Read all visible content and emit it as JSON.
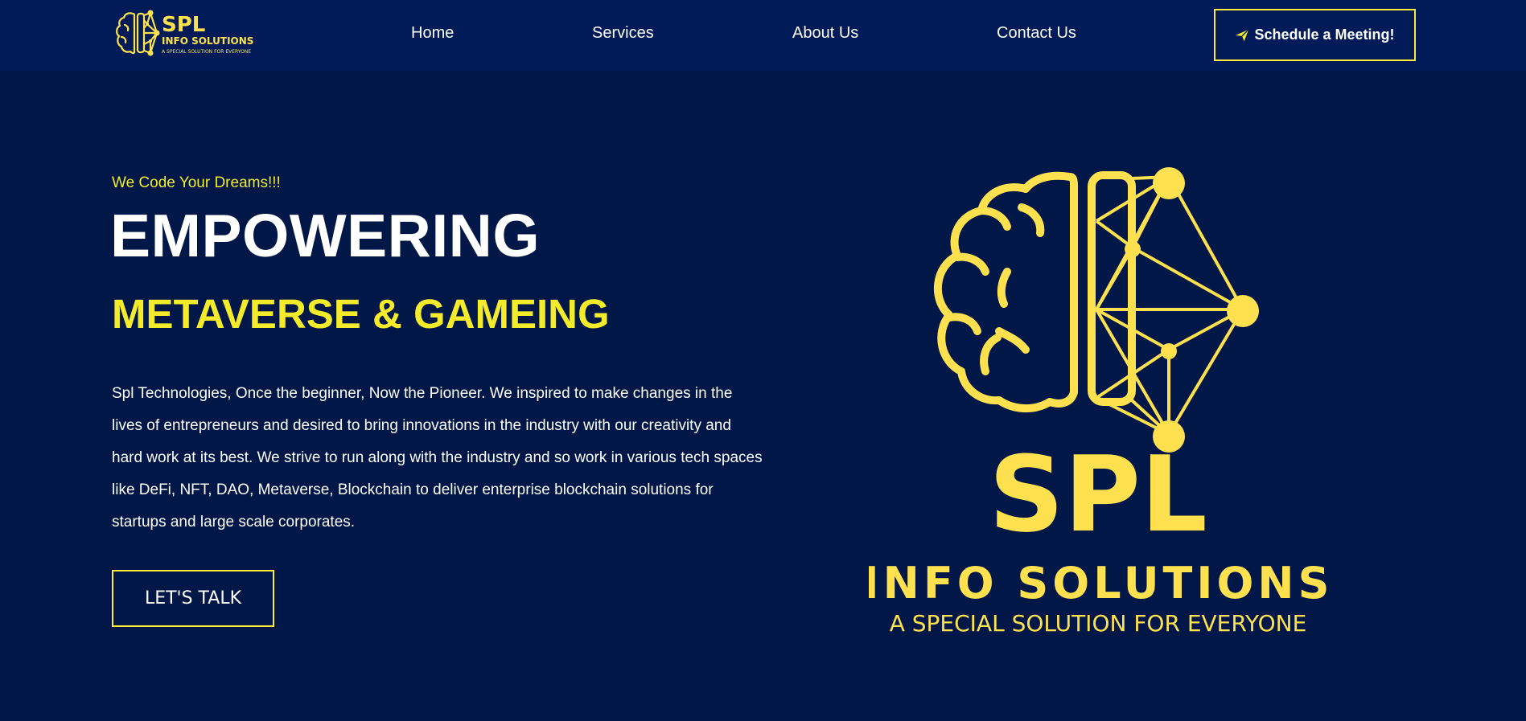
{
  "colors": {
    "background": "#001747",
    "navbar": "#001b57",
    "accent_yellow": "#f4ec2a",
    "logo_yellow": "#ffe14f",
    "text": "#ffffff"
  },
  "brand": {
    "name": "SPL",
    "subtitle": "INFO SOLUTIONS",
    "tagline": "A SPECIAL SOLUTION FOR EVERYONE"
  },
  "nav": {
    "links": [
      {
        "label": "Home"
      },
      {
        "label": "Services"
      },
      {
        "label": "About Us"
      },
      {
        "label": "Contact Us"
      }
    ],
    "cta_label": "Schedule a Meeting!",
    "cta_icon": "send-icon"
  },
  "hero": {
    "tagline": "We Code Your Dreams!!!",
    "headline": "EMPOWERING",
    "subheadline": "METAVERSE & GAMEING",
    "description": "Spl Technologies, Once the beginner, Now the Pioneer. We inspired to make changes in the lives of entrepreneurs and desired to bring innovations in the industry with our creativity and hard work at its best. We strive to run along with the industry and so work in various tech spaces like DeFi, NFT, DAO, Metaverse, Blockchain to deliver enterprise blockchain solutions for startups and large scale corporates.",
    "cta_label": "LET'S TALK"
  }
}
